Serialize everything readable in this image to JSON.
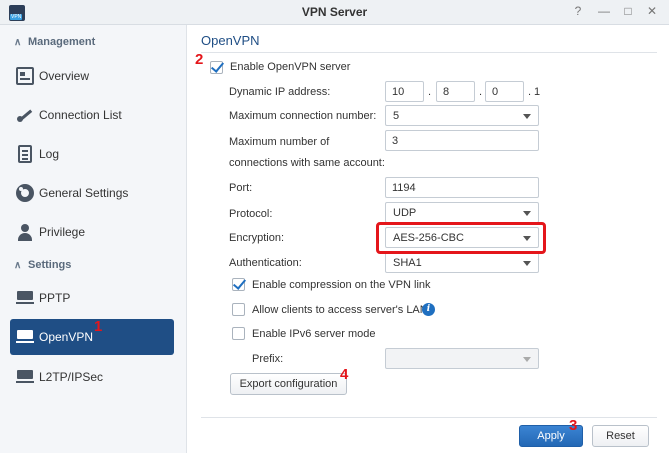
{
  "window": {
    "title": "VPN Server",
    "controls": [
      "?",
      "—",
      "□",
      "✕"
    ]
  },
  "sidebar": {
    "management_header": "Management",
    "settings_header": "Settings",
    "items": [
      {
        "label": "Overview"
      },
      {
        "label": "Connection List"
      },
      {
        "label": "Log"
      },
      {
        "label": "General Settings"
      },
      {
        "label": "Privilege"
      },
      {
        "label": "PPTP"
      },
      {
        "label": "OpenVPN"
      },
      {
        "label": "L2TP/IPSec"
      }
    ],
    "active_item": "OpenVPN"
  },
  "main": {
    "title": "OpenVPN",
    "enable_label": "Enable OpenVPN server",
    "enable_checked": true,
    "fields": {
      "dynamic_ip_label": "Dynamic IP address:",
      "ip_octets": [
        "10",
        "8",
        "0"
      ],
      "ip_dot": ".",
      "ip_last": "1",
      "max_conn_label": "Maximum connection number:",
      "max_conn_value": "5",
      "max_same_label_line1": "Maximum number of",
      "max_same_label_line2": "connections with same account:",
      "max_same_value": "3",
      "port_label": "Port:",
      "port_value": "1194",
      "protocol_label": "Protocol:",
      "protocol_value": "UDP",
      "encryption_label": "Encryption:",
      "encryption_value": "AES-256-CBC",
      "auth_label": "Authentication:",
      "auth_value": "SHA1"
    },
    "options": {
      "compression_label": "Enable compression on the VPN link",
      "compression_checked": true,
      "lan_access_label": "Allow clients to access server's LAN",
      "lan_access_checked": false,
      "ipv6_label": "Enable IPv6 server mode",
      "ipv6_checked": false,
      "prefix_label": "Prefix:",
      "prefix_value": ""
    },
    "export_button": "Export configuration"
  },
  "footer": {
    "apply_button": "Apply",
    "reset_button": "Reset"
  },
  "annotations": {
    "callouts": [
      "1",
      "2",
      "3",
      "4"
    ],
    "highlight_color": "#e4161b"
  },
  "colors": {
    "accent": "#1f4e85",
    "primary_button": "#2a72c2"
  }
}
